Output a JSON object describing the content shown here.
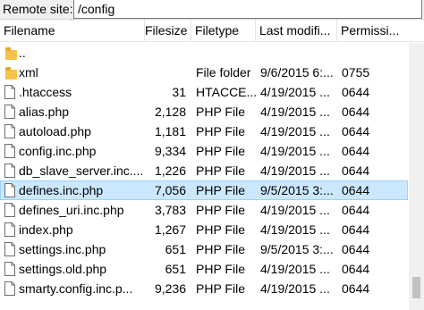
{
  "remote": {
    "label": "Remote site:",
    "path": "/config"
  },
  "columns": {
    "filename": "Filename",
    "filesize": "Filesize",
    "filetype": "Filetype",
    "last_modified": "Last modifi...",
    "permissions": "Permissi..."
  },
  "files": [
    {
      "name": "..",
      "size": "",
      "type": "",
      "modified": "",
      "perm": "",
      "icon": "folder-icon"
    },
    {
      "name": "xml",
      "size": "",
      "type": "File folder",
      "modified": "9/6/2015 6:...",
      "perm": "0755",
      "icon": "folder-icon"
    },
    {
      "name": ".htaccess",
      "size": "31",
      "type": "HTACCE...",
      "modified": "4/19/2015 ...",
      "perm": "0644",
      "icon": "file-icon"
    },
    {
      "name": "alias.php",
      "size": "2,128",
      "type": "PHP File",
      "modified": "4/19/2015 ...",
      "perm": "0644",
      "icon": "file-icon"
    },
    {
      "name": "autoload.php",
      "size": "1,181",
      "type": "PHP File",
      "modified": "4/19/2015 ...",
      "perm": "0644",
      "icon": "file-icon"
    },
    {
      "name": "config.inc.php",
      "size": "9,334",
      "type": "PHP File",
      "modified": "4/19/2015 ...",
      "perm": "0644",
      "icon": "file-icon"
    },
    {
      "name": "db_slave_server.inc....",
      "size": "1,226",
      "type": "PHP File",
      "modified": "4/19/2015 ...",
      "perm": "0644",
      "icon": "file-icon"
    },
    {
      "name": "defines.inc.php",
      "size": "7,056",
      "type": "PHP File",
      "modified": "9/5/2015 3:...",
      "perm": "0644",
      "icon": "file-icon"
    },
    {
      "name": "defines_uri.inc.php",
      "size": "3,783",
      "type": "PHP File",
      "modified": "4/19/2015 ...",
      "perm": "0644",
      "icon": "file-icon"
    },
    {
      "name": "index.php",
      "size": "1,267",
      "type": "PHP File",
      "modified": "4/19/2015 ...",
      "perm": "0644",
      "icon": "file-icon"
    },
    {
      "name": "settings.inc.php",
      "size": "651",
      "type": "PHP File",
      "modified": "9/5/2015 3:...",
      "perm": "0644",
      "icon": "file-icon"
    },
    {
      "name": "settings.old.php",
      "size": "651",
      "type": "PHP File",
      "modified": "4/19/2015 ...",
      "perm": "0644",
      "icon": "file-icon"
    },
    {
      "name": "smarty.config.inc.p...",
      "size": "9,236",
      "type": "PHP File",
      "modified": "4/19/2015 ...",
      "perm": "0644",
      "icon": "file-icon"
    }
  ],
  "selected_file": "defines.inc.php",
  "colors": {
    "selection_bg": "#cce8ff",
    "selection_border": "#99d1ff",
    "folder": "#f6c24a"
  }
}
